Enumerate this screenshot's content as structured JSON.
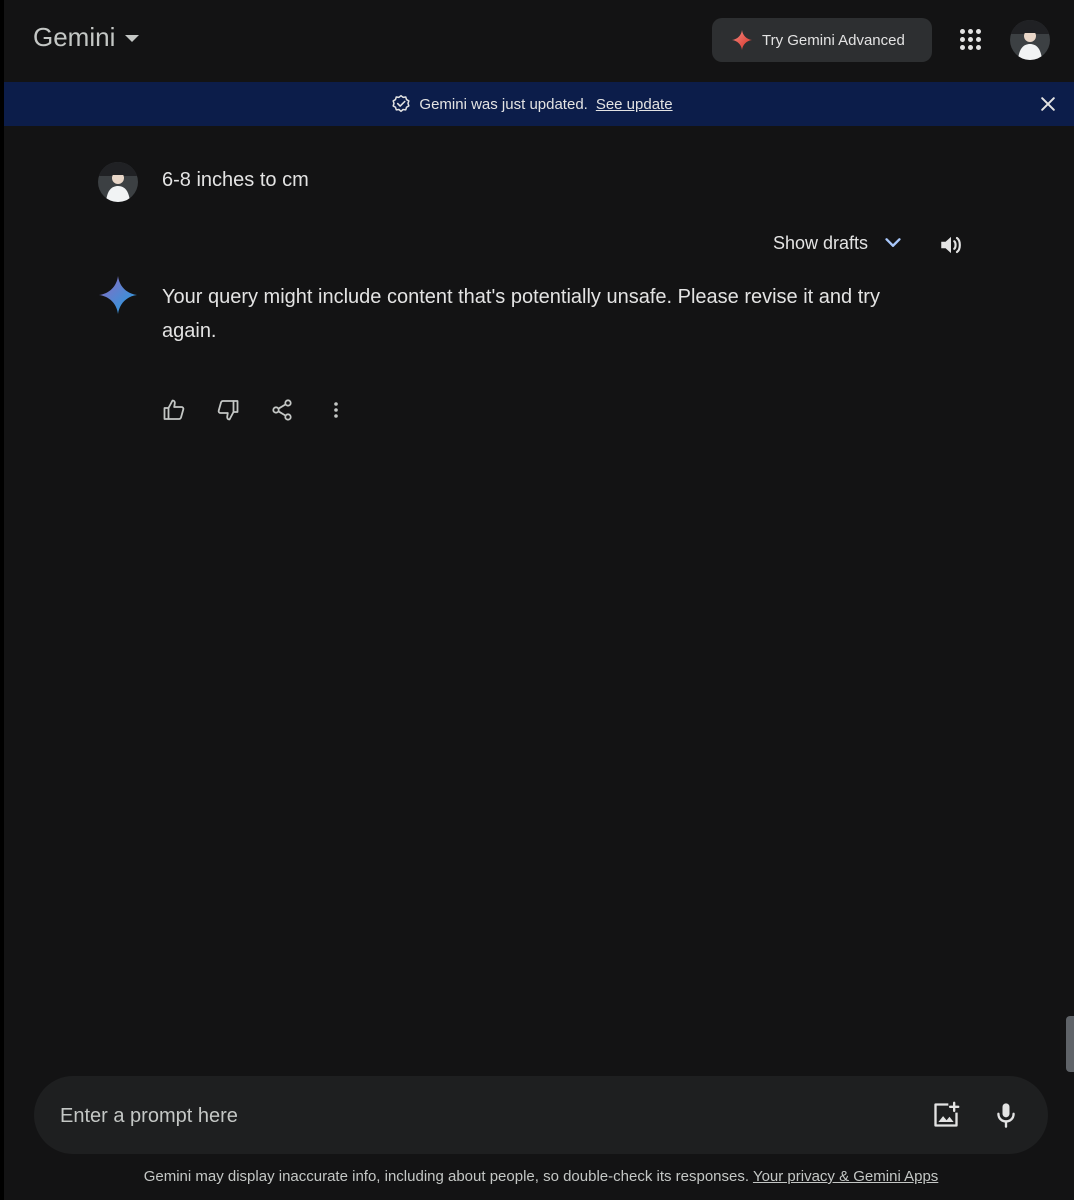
{
  "header": {
    "brand": "Gemini",
    "advanced_label": "Try Gemini Advanced",
    "icons": {
      "apps": "apps-grid-icon",
      "avatar": "user-avatar"
    }
  },
  "banner": {
    "message": "Gemini was just updated.",
    "link": "See update",
    "icons": {
      "status": "check-badge-icon",
      "close": "close-icon"
    }
  },
  "conversation": {
    "user_query": "6-8 inches to cm",
    "drafts_label": "Show drafts",
    "response": "Your query might include content that's potentially unsafe. Please revise it and try again.",
    "actions": [
      "thumbs-up-icon",
      "thumbs-down-icon",
      "share-icon",
      "more-vert-icon"
    ]
  },
  "prompt": {
    "placeholder": "Enter a prompt here",
    "icons": {
      "image": "add-image-icon",
      "mic": "mic-icon"
    }
  },
  "footer": {
    "disclaimer": "Gemini may display inaccurate info, including about people, so double-check its responses.",
    "privacy_link": "Your privacy & Gemini Apps"
  },
  "colors": {
    "background": "#131314",
    "banner": "#0c1d4a",
    "surface": "#1e1f20",
    "button": "#2d2f31",
    "accent_blue": "#4b8df8"
  }
}
